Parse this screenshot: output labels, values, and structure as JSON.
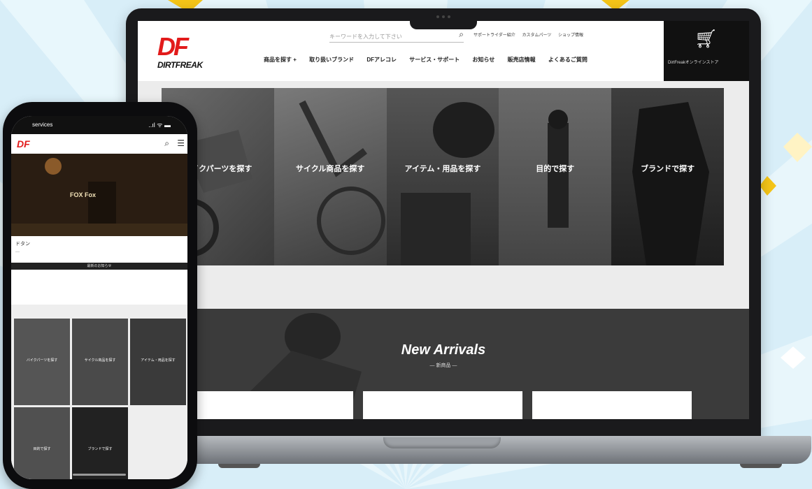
{
  "colors": {
    "brand_red": "#e21b1b",
    "background": "#d8eef8",
    "dark": "#111111"
  },
  "laptop": {
    "header": {
      "logo_mark": "DF",
      "logo_word": "DIRTFREAK",
      "search_placeholder": "キーワードを入力して下さい",
      "top_links": [
        "サポートライダー紹介",
        "カスタムパーツ",
        "ショップ情報"
      ],
      "nav": [
        "商品を探す +",
        "取り扱いブランド",
        "DFアレコレ",
        "サービス・サポート",
        "お知らせ",
        "販売店情報",
        "よくあるご質問"
      ],
      "cart_icon": "cart-icon",
      "store_label": "DirtFreakオンラインストア"
    },
    "categories": [
      {
        "label": "バイクパーツを探す"
      },
      {
        "label": "サイクル商品を探す"
      },
      {
        "label": "アイテム・用品を探す"
      },
      {
        "label": "目的で探す"
      },
      {
        "label": "ブランドで探す"
      }
    ],
    "arrivals": {
      "title": "New Arrivals",
      "subtitle": "— 新商品 —"
    }
  },
  "phone": {
    "status_time": "services",
    "status_icons": "..ıl ᯤ ▬",
    "logo": "DF",
    "hero_caption": "FOX Fox",
    "caption": "ドタン",
    "caption2": "---",
    "bar_label": "最新のお知らせ",
    "tiles": [
      {
        "label": "バイクパーツを探す"
      },
      {
        "label": "サイクル商品を探す"
      },
      {
        "label": "アイテム・用品を探す"
      },
      {
        "label": "目的で探す"
      },
      {
        "label": "ブランドで探す"
      }
    ]
  }
}
